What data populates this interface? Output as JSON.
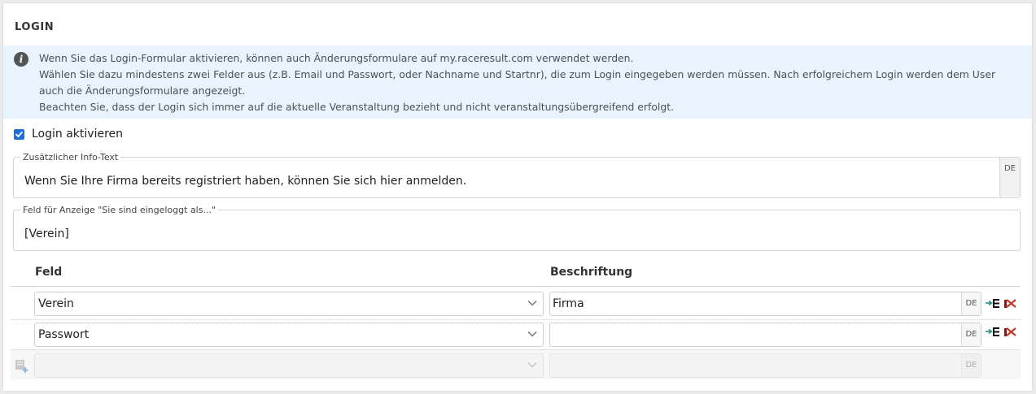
{
  "card": {
    "title": "LOGIN"
  },
  "info": {
    "icon": "info-icon",
    "lines": [
      "Wenn Sie das Login-Formular aktivieren, können auch Änderungsformulare auf my.raceresult.com verwendet werden.",
      "Wählen Sie dazu mindestens zwei Felder aus (z.B. Email und Passwort, oder Nachname und Startnr), die zum Login eingegeben werden müssen. Nach erfolgreichem Login werden dem User auch die Änderungsformulare angezeigt.",
      "Beachten Sie, dass der Login sich immer auf die aktuelle Veranstaltung bezieht und nicht veranstaltungsübergreifend erfolgt."
    ]
  },
  "login_checkbox": {
    "label": "Login aktivieren",
    "checked": true
  },
  "info_text_field": {
    "legend": "Zusätzlicher Info-Text",
    "value": "Wenn Sie Ihre Firma bereits registriert haben, können Sie sich hier anmelden.",
    "lang": "DE"
  },
  "display_field": {
    "legend": "Feld für Anzeige \"Sie sind eingeloggt als...\"",
    "value": "[Verein]"
  },
  "table": {
    "headers": {
      "field": "Feld",
      "caption": "Beschriftung"
    },
    "rows": [
      {
        "field": "Verein",
        "caption": "Firma",
        "lang": "DE"
      },
      {
        "field": "Passwort",
        "caption": "",
        "lang": "DE"
      }
    ],
    "new_row": {
      "field": "",
      "caption": "",
      "lang": "DE"
    }
  },
  "colors": {
    "accent": "#1e6fd1",
    "info_bg": "#e8f3fd",
    "delete_red": "#c0392b",
    "move_teal": "#2a8c8c"
  }
}
